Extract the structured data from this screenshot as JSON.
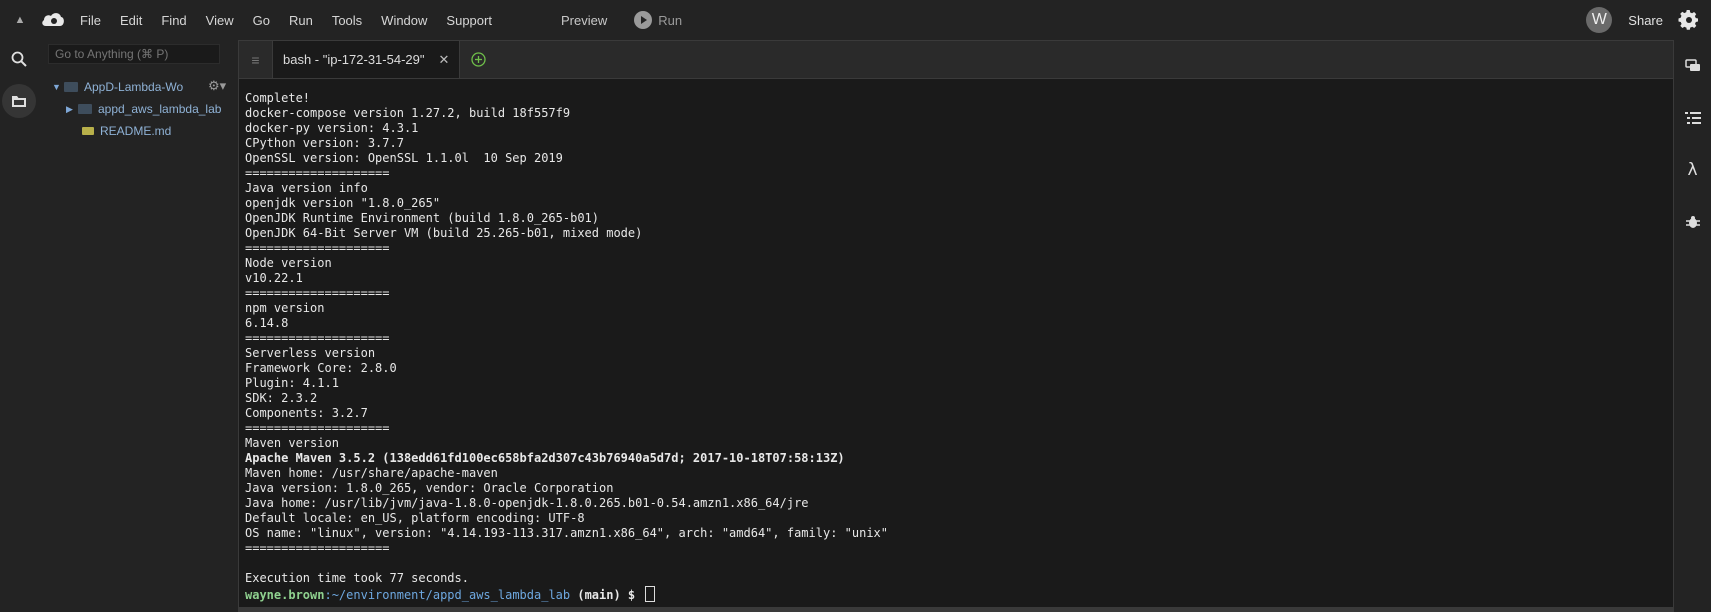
{
  "menubar": {
    "items": [
      "File",
      "Edit",
      "Find",
      "View",
      "Go",
      "Run",
      "Tools",
      "Window",
      "Support"
    ],
    "preview": "Preview",
    "run": "Run",
    "avatar_letter": "W",
    "share": "Share"
  },
  "tree": {
    "search_placeholder": "Go to Anything (⌘ P)",
    "root": "AppD-Lambda-Wo",
    "folder": "appd_aws_lambda_lab",
    "file": "README.md"
  },
  "terminal": {
    "tab_title": "bash - \"ip-172-31-54-29\"",
    "lines": [
      "Complete!",
      "docker-compose version 1.27.2, build 18f557f9",
      "docker-py version: 4.3.1",
      "CPython version: 3.7.7",
      "OpenSSL version: OpenSSL 1.1.0l  10 Sep 2019",
      "====================",
      "Java version info",
      "openjdk version \"1.8.0_265\"",
      "OpenJDK Runtime Environment (build 1.8.0_265-b01)",
      "OpenJDK 64-Bit Server VM (build 25.265-b01, mixed mode)",
      "====================",
      "Node version",
      "v10.22.1",
      "====================",
      "npm version",
      "6.14.8",
      "====================",
      "Serverless version",
      "Framework Core: 2.8.0",
      "Plugin: 4.1.1",
      "SDK: 2.3.2",
      "Components: 3.2.7",
      "====================",
      "Maven version"
    ],
    "bold_line": "Apache Maven 3.5.2 (138edd61fd100ec658bfa2d307c43b76940a5d7d; 2017-10-18T07:58:13Z)",
    "lines2": [
      "Maven home: /usr/share/apache-maven",
      "Java version: 1.8.0_265, vendor: Oracle Corporation",
      "Java home: /usr/lib/jvm/java-1.8.0-openjdk-1.8.0.265.b01-0.54.amzn1.x86_64/jre",
      "Default locale: en_US, platform encoding: UTF-8",
      "OS name: \"linux\", version: \"4.14.193-113.317.amzn1.x86_64\", arch: \"amd64\", family: \"unix\"",
      "====================",
      "",
      "Execution time took 77 seconds."
    ],
    "prompt_user": "wayne.brown",
    "prompt_path": ":~/environment/appd_aws_lambda_lab",
    "prompt_rest": " (main) $ "
  },
  "colors": {
    "accent_green": "#8fd18f",
    "accent_blue": "#6ea8e0"
  }
}
